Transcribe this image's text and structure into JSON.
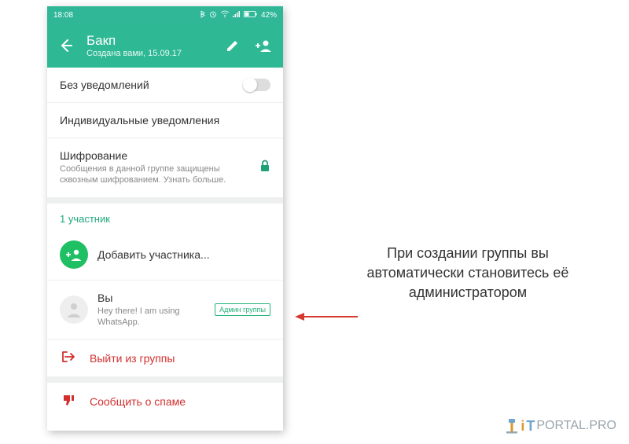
{
  "statusbar": {
    "time": "18:08",
    "battery": "42%"
  },
  "appbar": {
    "title": "Бакп",
    "subtitle": "Создана вами, 15.09.17"
  },
  "settings": {
    "mute": {
      "title": "Без уведомлений"
    },
    "custom_notif": {
      "title": "Индивидуальные уведомления"
    },
    "encryption": {
      "title": "Шифрование",
      "sub": "Сообщения в данной группе защищены сквозным шифрованием. Узнать больше."
    }
  },
  "participants": {
    "header": "1 участник",
    "add_label": "Добавить участника...",
    "you": {
      "name": "Вы",
      "status": "Hey there! I am using WhatsApp.",
      "badge": "Админ группы"
    }
  },
  "actions": {
    "leave": "Выйти из группы",
    "report": "Сообщить о спаме"
  },
  "annotation": "При создании группы вы автоматически становитесь её администратором",
  "watermark": {
    "i": "i",
    "t": "T",
    "rest": "PORTAL.PRO"
  }
}
